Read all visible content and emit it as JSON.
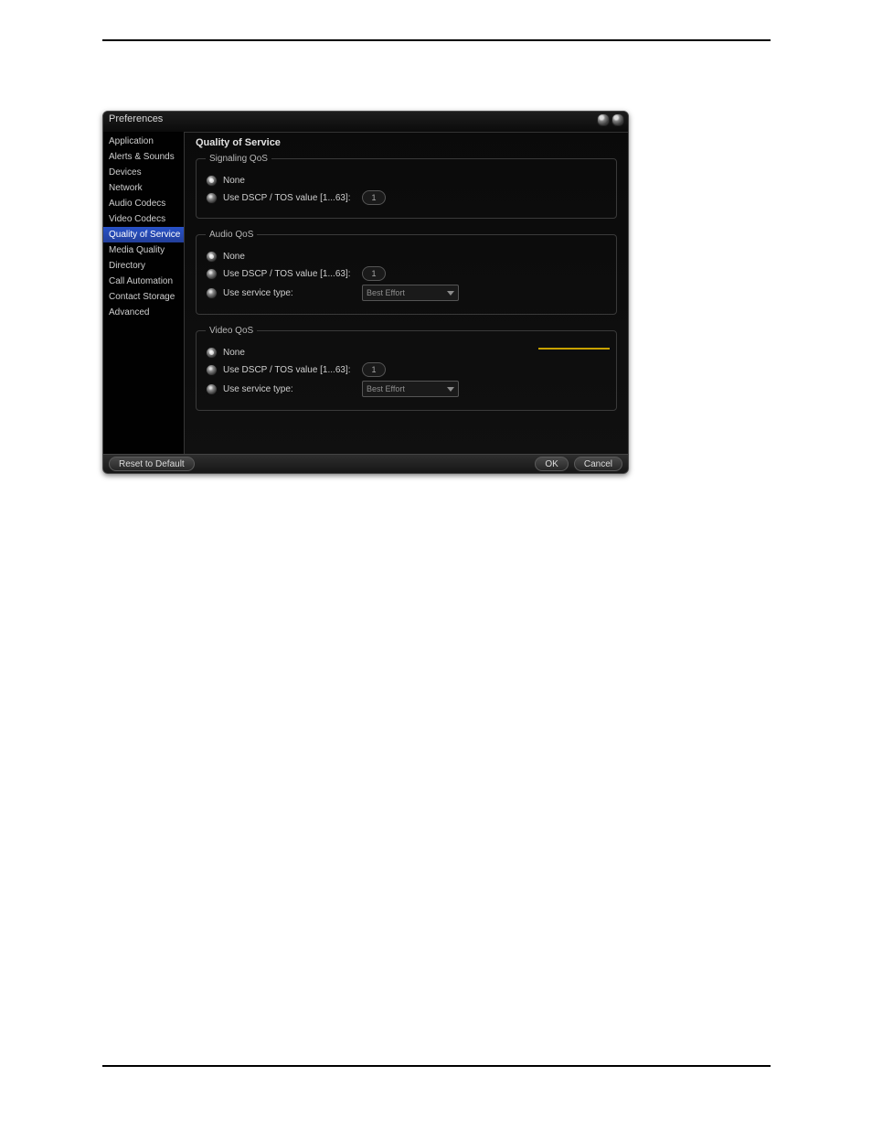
{
  "window": {
    "title": "Preferences"
  },
  "sidebar": {
    "items": [
      {
        "label": "Application"
      },
      {
        "label": "Alerts & Sounds"
      },
      {
        "label": "Devices"
      },
      {
        "label": "Network"
      },
      {
        "label": "Audio Codecs"
      },
      {
        "label": "Video Codecs"
      },
      {
        "label": "Quality of Service",
        "selected": true
      },
      {
        "label": "Media Quality"
      },
      {
        "label": "Directory"
      },
      {
        "label": "Call Automation"
      },
      {
        "label": "Contact Storage"
      },
      {
        "label": "Advanced"
      }
    ]
  },
  "panel": {
    "title": "Quality of Service",
    "signaling": {
      "legend": "Signaling QoS",
      "opt_none": "None",
      "opt_dscp": "Use DSCP / TOS value [1...63]:",
      "dscp_value": "1"
    },
    "audio": {
      "legend": "Audio QoS",
      "opt_none": "None",
      "opt_dscp": "Use DSCP / TOS value [1...63]:",
      "dscp_value": "1",
      "opt_service": "Use service type:",
      "service_value": "Best Effort"
    },
    "video": {
      "legend": "Video QoS",
      "opt_none": "None",
      "opt_dscp": "Use DSCP / TOS value [1...63]:",
      "dscp_value": "1",
      "opt_service": "Use service type:",
      "service_value": "Best Effort"
    }
  },
  "footer": {
    "reset": "Reset to Default",
    "ok": "OK",
    "cancel": "Cancel"
  }
}
